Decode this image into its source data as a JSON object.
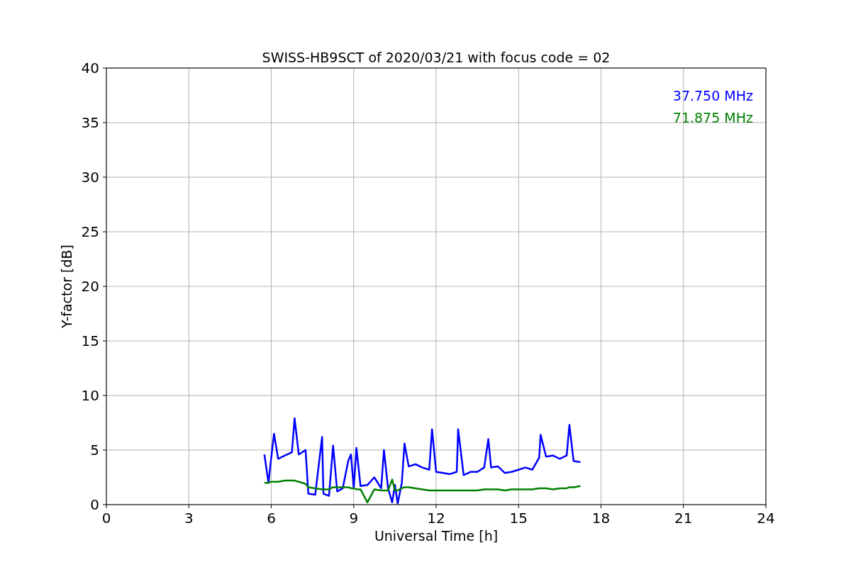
{
  "chart_data": {
    "type": "line",
    "title": "SWISS-HB9SCT of 2020/03/21 with focus code = 02",
    "xlabel": "Universal Time [h]",
    "ylabel": "Y-factor [dB]",
    "x": [
      5.75,
      5.9,
      6.0,
      6.1,
      6.25,
      6.5,
      6.75,
      6.85,
      7.0,
      7.25,
      7.35,
      7.6,
      7.85,
      7.9,
      8.1,
      8.25,
      8.4,
      8.6,
      8.8,
      8.9,
      9.0,
      9.1,
      9.25,
      9.5,
      9.75,
      10.0,
      10.1,
      10.25,
      10.4,
      10.5,
      10.6,
      10.75,
      10.85,
      11.0,
      11.25,
      11.5,
      11.75,
      11.85,
      12.0,
      12.25,
      12.5,
      12.75,
      12.8,
      13.0,
      13.25,
      13.5,
      13.75,
      13.9,
      14.0,
      14.25,
      14.5,
      14.75,
      15.0,
      15.25,
      15.5,
      15.75,
      15.8,
      16.0,
      16.25,
      16.5,
      16.75,
      16.85,
      17.0,
      17.25
    ],
    "series": [
      {
        "name": "37.750 MHz",
        "color": "#0000ff",
        "values": [
          4.6,
          2.0,
          4.3,
          6.5,
          4.2,
          4.5,
          4.8,
          7.9,
          4.6,
          5.0,
          1.0,
          0.9,
          6.2,
          1.0,
          0.8,
          5.4,
          1.2,
          1.5,
          4.0,
          4.6,
          1.5,
          5.2,
          1.7,
          1.8,
          2.5,
          1.5,
          5.0,
          1.5,
          0.2,
          1.8,
          0.1,
          2.0,
          5.6,
          3.5,
          3.7,
          3.4,
          3.2,
          6.9,
          3.0,
          2.9,
          2.8,
          3.0,
          6.9,
          2.7,
          3.0,
          3.0,
          3.4,
          6.0,
          3.4,
          3.5,
          2.9,
          3.0,
          3.2,
          3.4,
          3.2,
          4.3,
          6.4,
          4.4,
          4.5,
          4.2,
          4.5,
          7.3,
          4.0,
          3.9
        ]
      },
      {
        "name": "71.875 MHz",
        "color": "#008000",
        "values": [
          2.0,
          2.0,
          2.1,
          2.1,
          2.1,
          2.2,
          2.2,
          2.2,
          2.1,
          1.9,
          1.6,
          1.5,
          1.4,
          1.4,
          1.4,
          1.6,
          1.6,
          1.6,
          1.6,
          1.5,
          1.5,
          1.4,
          1.4,
          0.2,
          1.4,
          1.3,
          1.3,
          1.3,
          2.3,
          1.3,
          1.3,
          1.5,
          1.6,
          1.6,
          1.5,
          1.4,
          1.3,
          1.3,
          1.3,
          1.3,
          1.3,
          1.3,
          1.3,
          1.3,
          1.3,
          1.3,
          1.4,
          1.4,
          1.4,
          1.4,
          1.3,
          1.4,
          1.4,
          1.4,
          1.4,
          1.5,
          1.5,
          1.5,
          1.4,
          1.5,
          1.5,
          1.6,
          1.6,
          1.7
        ]
      }
    ],
    "grid": true,
    "xlim": [
      0,
      24
    ],
    "ylim": [
      0,
      40
    ],
    "xticks": [
      0,
      3,
      6,
      9,
      12,
      15,
      18,
      21,
      24
    ],
    "yticks": [
      0,
      5,
      10,
      15,
      20,
      25,
      30,
      35,
      40
    ]
  }
}
